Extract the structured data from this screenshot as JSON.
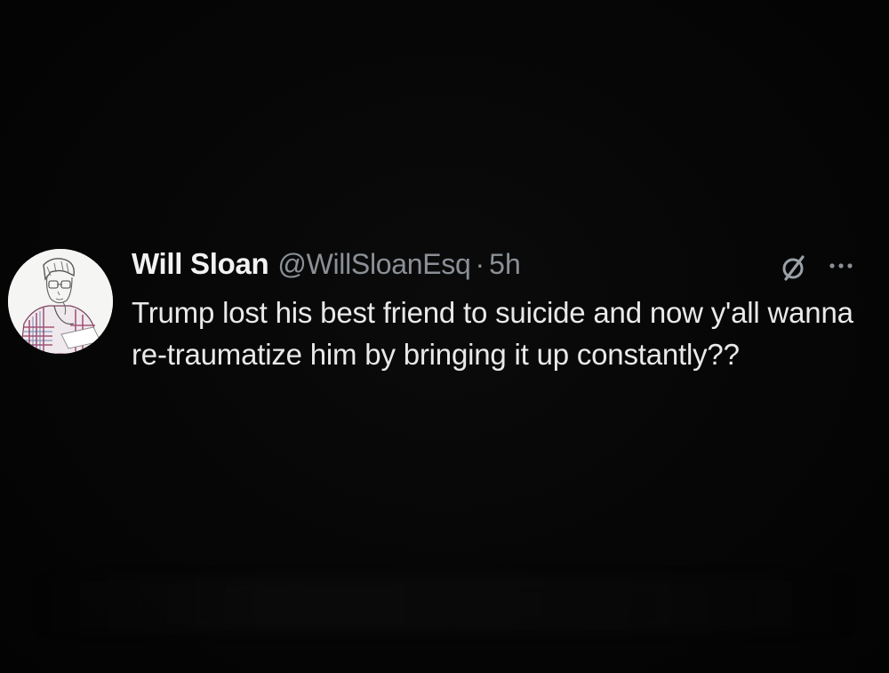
{
  "tweet": {
    "display_name": "Will Sloan",
    "handle": "@WillSloanEsq",
    "separator": "·",
    "time": "5h",
    "text": "Trump lost his best friend to suicide and now y'all wanna re-traumatize him by bringing it up constantly??",
    "icons": {
      "grok": "grok-icon",
      "more": "more-options-icon",
      "avatar": "avatar"
    }
  },
  "colors": {
    "background": "#050505",
    "primary_text": "#e9e9e9",
    "secondary_text": "#8b9096"
  }
}
